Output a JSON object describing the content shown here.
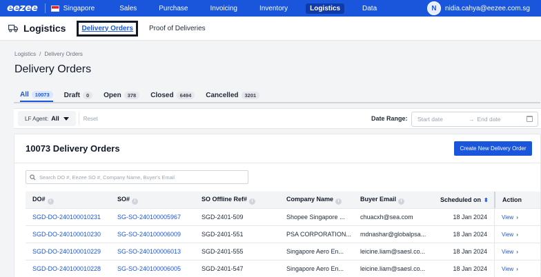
{
  "brand": {
    "logo": "eezee",
    "accent": "#1a56db"
  },
  "topnav": {
    "country": "Singapore",
    "items": [
      {
        "label": "Sales",
        "active": false
      },
      {
        "label": "Purchase",
        "active": false
      },
      {
        "label": "Invoicing",
        "active": false
      },
      {
        "label": "Inventory",
        "active": false
      },
      {
        "label": "Logistics",
        "active": true
      },
      {
        "label": "Data",
        "active": false
      }
    ],
    "user": {
      "initial": "N",
      "email": "nidia.cahya@eezee.com.sg"
    }
  },
  "module": {
    "icon": "truck-icon",
    "title": "Logistics",
    "tabs": [
      {
        "label": "Delivery Orders",
        "active": true
      },
      {
        "label": "Proof of Deliveries",
        "active": false
      }
    ]
  },
  "breadcrumb": {
    "root": "Logistics",
    "separator": "/",
    "current": "Delivery Orders"
  },
  "page_title": "Delivery Orders",
  "status_tabs": [
    {
      "label": "All",
      "count": "10073",
      "active": true
    },
    {
      "label": "Draft",
      "count": "0",
      "active": false
    },
    {
      "label": "Open",
      "count": "378",
      "active": false
    },
    {
      "label": "Closed",
      "count": "6494",
      "active": false
    },
    {
      "label": "Cancelled",
      "count": "3201",
      "active": false
    }
  ],
  "filters": {
    "agent_label": "LF Agent:",
    "agent_value": "All",
    "reset_label": "Reset",
    "date_range_label": "Date Range:",
    "start_placeholder": "Start date",
    "arrow": "→",
    "end_placeholder": "End date"
  },
  "card": {
    "title": "10073 Delivery Orders",
    "new_button": "Create New Delivery Order",
    "search_placeholder": "Search DO #, Eezee SO #, Company Name, Buyer's Email"
  },
  "table": {
    "columns": [
      "DO#",
      "SO#",
      "SO Offline Ref#",
      "Company Name",
      "Buyer Email",
      "Scheduled on",
      "Action"
    ],
    "rows": [
      {
        "do": "SGD-DO-240100010231",
        "so": "SG-SO-240100005967",
        "ref": "SGD-2401-509",
        "company": "Shopee Singapore ...",
        "email": "chuacxh@sea.com",
        "scheduled": "18 Jan 2024",
        "action": "View"
      },
      {
        "do": "SGD-DO-240100010230",
        "so": "SG-SO-240100006009",
        "ref": "SGD-2401-551",
        "company": "PSA CORPORATION...",
        "email": "mdnashar@globalpsa...",
        "scheduled": "18 Jan 2024",
        "action": "View"
      },
      {
        "do": "SGD-DO-240100010229",
        "so": "SG-SO-240100006013",
        "ref": "SGD-2401-555",
        "company": "Singapore Aero En...",
        "email": "leicine.liam@saesl.co...",
        "scheduled": "18 Jan 2024",
        "action": "View"
      },
      {
        "do": "SGD-DO-240100010228",
        "so": "SG-SO-240100006005",
        "ref": "SGD-2401-547",
        "company": "Singapore Aero En...",
        "email": "leicine.liam@saesl.co...",
        "scheduled": "18 Jan 2024",
        "action": "View"
      }
    ]
  }
}
